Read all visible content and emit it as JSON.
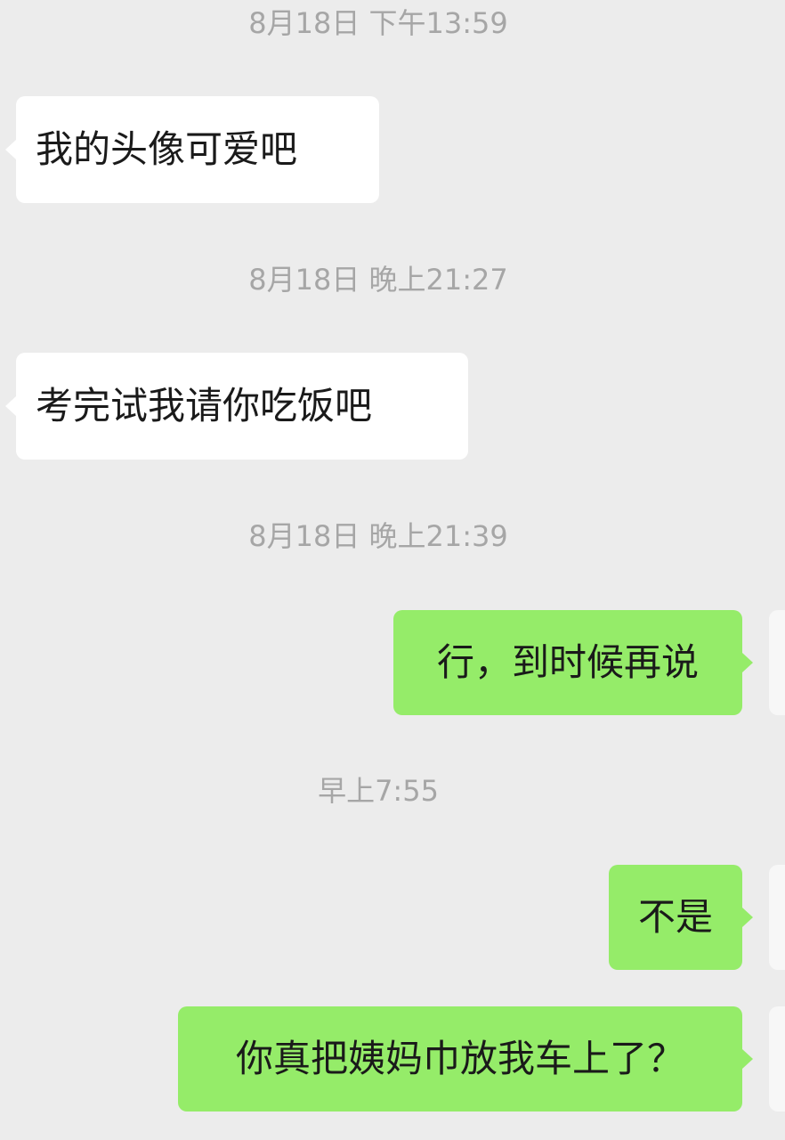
{
  "chat": {
    "items": [
      {
        "kind": "timestamp",
        "text": "8月18日 下午13:59"
      },
      {
        "kind": "message",
        "side": "incoming",
        "text": "我的头像可爱吧"
      },
      {
        "kind": "timestamp",
        "text": "8月18日 晚上21:27"
      },
      {
        "kind": "message",
        "side": "incoming",
        "text": "考完试我请你吃饭吧"
      },
      {
        "kind": "timestamp",
        "text": "8月18日 晚上21:39"
      },
      {
        "kind": "message",
        "side": "outgoing",
        "text": "行，到时候再说"
      },
      {
        "kind": "timestamp",
        "text": "早上7:55"
      },
      {
        "kind": "message",
        "side": "outgoing",
        "text": "不是"
      },
      {
        "kind": "message",
        "side": "outgoing",
        "text": "你真把姨妈巾放我车上了？"
      }
    ]
  },
  "colors": {
    "background": "#ececec",
    "incoming_bubble": "#ffffff",
    "outgoing_bubble": "#95ec69",
    "timestamp_text": "#a6a6a6"
  }
}
